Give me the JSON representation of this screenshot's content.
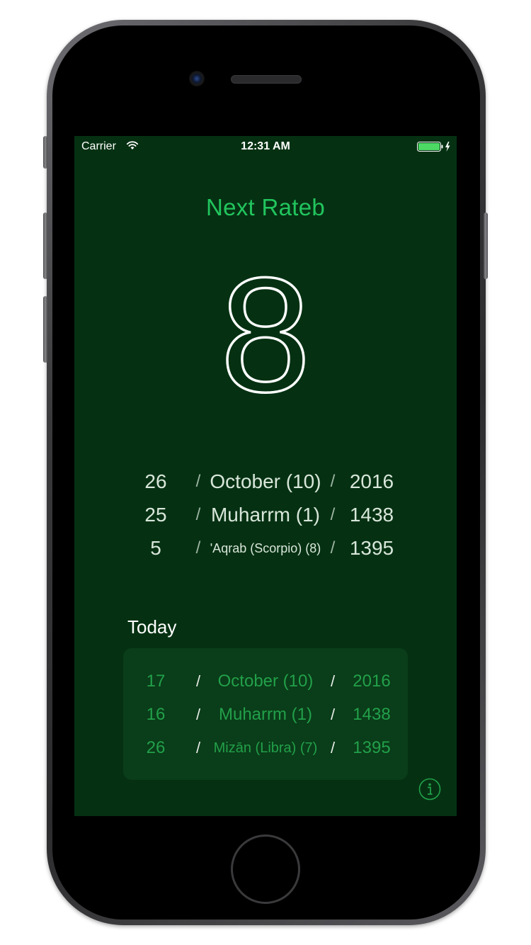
{
  "status_bar": {
    "carrier": "Carrier",
    "time": "12:31 AM"
  },
  "header": {
    "title": "Next Rateb"
  },
  "countdown": {
    "value": "8"
  },
  "next_dates": [
    {
      "day": "26",
      "month": "October (10)",
      "year": "2016"
    },
    {
      "day": "25",
      "month": "Muharrm (1)",
      "year": "1438"
    },
    {
      "day": "5",
      "month": "'Aqrab (Scorpio) (8)",
      "year": "1395"
    }
  ],
  "separator": "/",
  "today": {
    "label": "Today",
    "dates": [
      {
        "day": "17",
        "month": "October (10)",
        "year": "2016"
      },
      {
        "day": "16",
        "month": "Muharrm (1)",
        "year": "1438"
      },
      {
        "day": "26",
        "month": "Mizān (Libra) (7)",
        "year": "1395"
      }
    ]
  },
  "icons": {
    "wifi": "wifi-icon",
    "battery": "battery-charging-icon",
    "info": "info-icon"
  },
  "colors": {
    "background": "#053112",
    "accent": "#22c55e",
    "today_panel": "#0a3d19"
  }
}
